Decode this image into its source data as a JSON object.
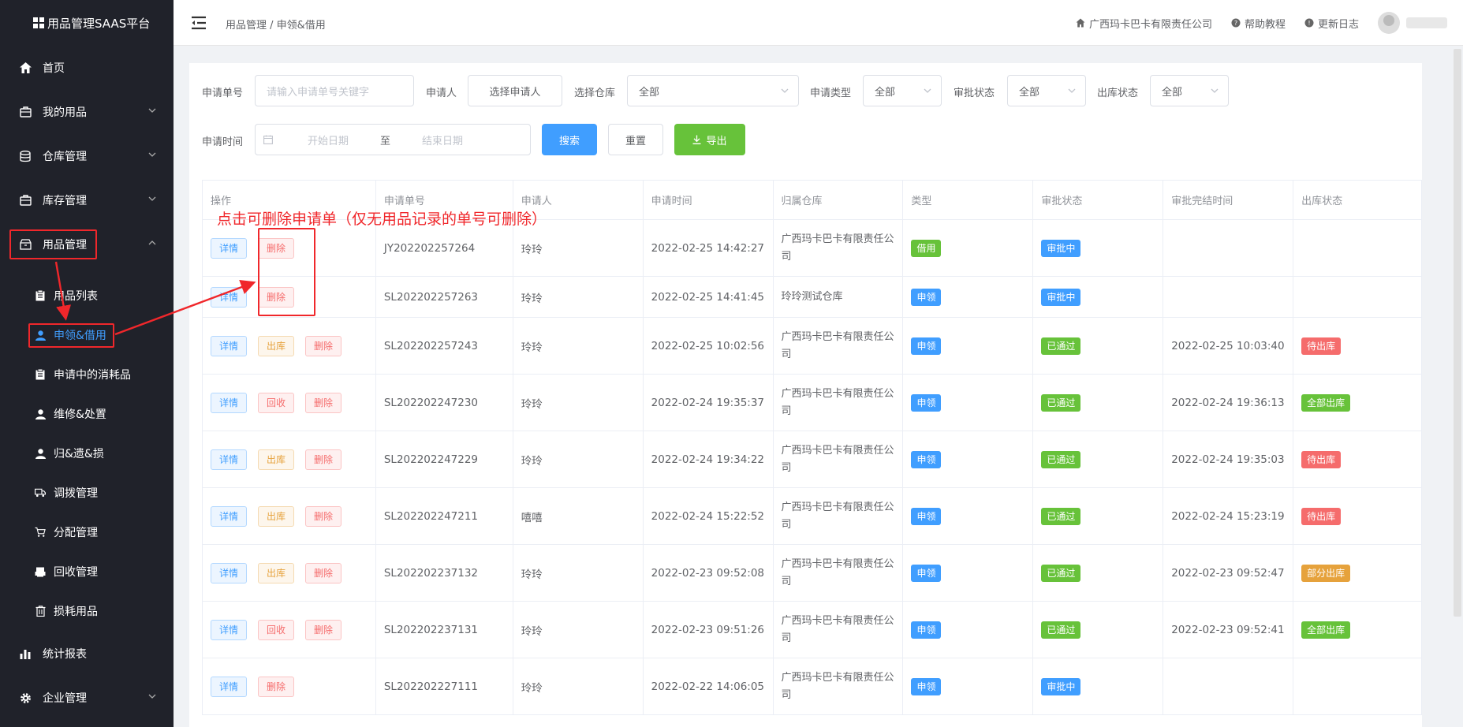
{
  "brand": "用品管理SAAS平台",
  "sidebar": {
    "menu": [
      {
        "label": "首页",
        "icon": "home-icon"
      },
      {
        "label": "我的用品",
        "icon": "briefcase-icon"
      },
      {
        "label": "仓库管理",
        "icon": "database-icon"
      },
      {
        "label": "库存管理",
        "icon": "briefcase-icon"
      },
      {
        "label": "用品管理",
        "icon": "box-icon"
      }
    ],
    "sub": [
      {
        "label": "用品列表",
        "icon": "clipboard-icon"
      },
      {
        "label": "申领&借用",
        "icon": "user-icon"
      },
      {
        "label": "申请中的消耗品",
        "icon": "clipboard-icon"
      },
      {
        "label": "维修&处置",
        "icon": "user-icon"
      },
      {
        "label": "归&遗&损",
        "icon": "user-icon"
      },
      {
        "label": "调拨管理",
        "icon": "truck-icon"
      },
      {
        "label": "分配管理",
        "icon": "cart-icon"
      },
      {
        "label": "回收管理",
        "icon": "printer-icon"
      },
      {
        "label": "损耗用品",
        "icon": "trash-icon"
      }
    ],
    "bottom": [
      {
        "label": "统计报表",
        "icon": "bar-chart-icon"
      },
      {
        "label": "企业管理",
        "icon": "gear-icon"
      }
    ]
  },
  "header": {
    "breadcrumb": "用品管理 / 申领&借用",
    "company": "广西玛卡巴卡有限责任公司",
    "help": "帮助教程",
    "changelog": "更新日志"
  },
  "filters": {
    "no_label": "申请单号",
    "no_placeholder": "请输入申请单号关键字",
    "applicant_label": "申请人",
    "applicant_button": "选择申请人",
    "warehouse_label": "选择仓库",
    "warehouse_value": "全部",
    "type_label": "申请类型",
    "type_value": "全部",
    "approval_label": "审批状态",
    "approval_value": "全部",
    "outbound_label": "出库状态",
    "outbound_value": "全部",
    "time_label": "申请时间",
    "start_placeholder": "开始日期",
    "to": "至",
    "end_placeholder": "结束日期",
    "search": "搜索",
    "reset": "重置",
    "export": "导出"
  },
  "annotation": "点击可删除申请单（仅无用品记录的单号可删除）",
  "table": {
    "columns": [
      "操作",
      "申请单号",
      "申请人",
      "申请时间",
      "归属仓库",
      "类型",
      "审批状态",
      "审批完结时间",
      "出库状态"
    ],
    "rows": [
      {
        "ops": [
          "详情",
          "删除"
        ],
        "no": "JY202202257264",
        "applicant": "玲玲",
        "time": "2022-02-25 14:42:27",
        "warehouse": "广西玛卡巴卡有限责任公司",
        "type": "借用",
        "approval": "审批中",
        "done": "",
        "outbound": ""
      },
      {
        "ops": [
          "详情",
          "删除"
        ],
        "no": "SL202202257263",
        "applicant": "玲玲",
        "time": "2022-02-25 14:41:45",
        "warehouse": "玲玲测试仓库",
        "type": "申领",
        "approval": "审批中",
        "done": "",
        "outbound": ""
      },
      {
        "ops": [
          "详情",
          "出库",
          "删除"
        ],
        "no": "SL202202257243",
        "applicant": "玲玲",
        "time": "2022-02-25 10:02:56",
        "warehouse": "广西玛卡巴卡有限责任公司",
        "type": "申领",
        "approval": "已通过",
        "done": "2022-02-25 10:03:40",
        "outbound": "待出库"
      },
      {
        "ops": [
          "详情",
          "回收",
          "删除"
        ],
        "no": "SL202202247230",
        "applicant": "玲玲",
        "time": "2022-02-24 19:35:37",
        "warehouse": "广西玛卡巴卡有限责任公司",
        "type": "申领",
        "approval": "已通过",
        "done": "2022-02-24 19:36:13",
        "outbound": "全部出库"
      },
      {
        "ops": [
          "详情",
          "出库",
          "删除"
        ],
        "no": "SL202202247229",
        "applicant": "玲玲",
        "time": "2022-02-24 19:34:22",
        "warehouse": "广西玛卡巴卡有限责任公司",
        "type": "申领",
        "approval": "已通过",
        "done": "2022-02-24 19:35:03",
        "outbound": "待出库"
      },
      {
        "ops": [
          "详情",
          "出库",
          "删除"
        ],
        "no": "SL202202247211",
        "applicant": "嘻嘻",
        "time": "2022-02-24 15:22:52",
        "warehouse": "广西玛卡巴卡有限责任公司",
        "type": "申领",
        "approval": "已通过",
        "done": "2022-02-24 15:23:19",
        "outbound": "待出库"
      },
      {
        "ops": [
          "详情",
          "出库",
          "删除"
        ],
        "no": "SL202202237132",
        "applicant": "玲玲",
        "time": "2022-02-23 09:52:08",
        "warehouse": "广西玛卡巴卡有限责任公司",
        "type": "申领",
        "approval": "已通过",
        "done": "2022-02-23 09:52:47",
        "outbound": "部分出库"
      },
      {
        "ops": [
          "详情",
          "回收",
          "删除"
        ],
        "no": "SL202202237131",
        "applicant": "玲玲",
        "time": "2022-02-23 09:51:26",
        "warehouse": "广西玛卡巴卡有限责任公司",
        "type": "申领",
        "approval": "已通过",
        "done": "2022-02-23 09:52:41",
        "outbound": "全部出库"
      },
      {
        "ops": [
          "详情",
          "删除"
        ],
        "no": "SL202202227111",
        "applicant": "玲玲",
        "time": "2022-02-22 14:06:05",
        "warehouse": "广西玛卡巴卡有限责任公司",
        "type": "申领",
        "approval": "审批中",
        "done": "",
        "outbound": ""
      }
    ]
  },
  "colors": {
    "sidebar_bg": "#20222a",
    "primary": "#409eff",
    "success": "#67c23a",
    "danger": "#f56c6c",
    "warning": "#e6a23c",
    "annotation": "#f0272b"
  }
}
